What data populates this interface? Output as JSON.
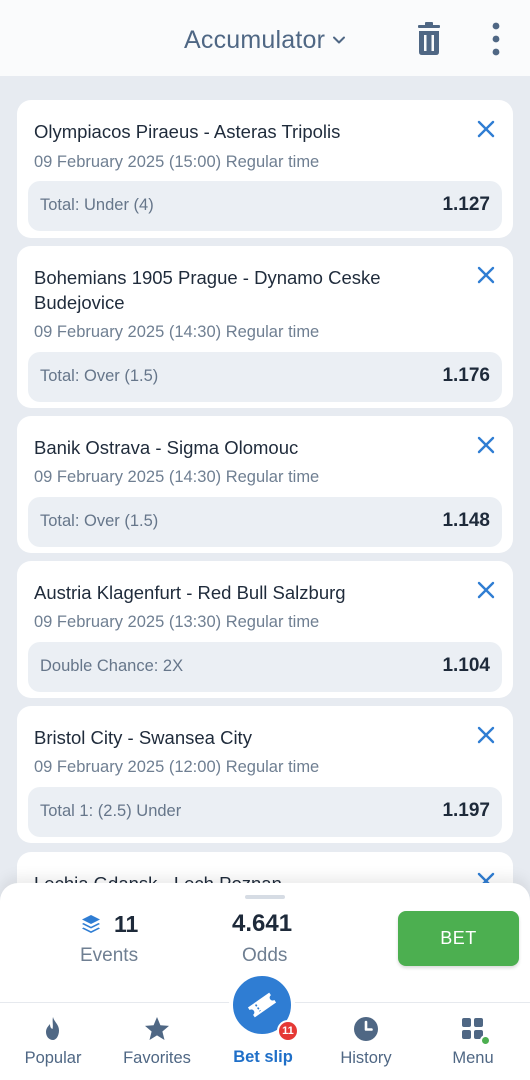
{
  "header": {
    "title": "Accumulator",
    "icons": [
      "chevron-down-icon",
      "trash-icon",
      "kebab-menu-icon"
    ]
  },
  "bets": [
    {
      "teams": "Olympiacos Piraeus - Asteras Tripolis",
      "when": "09 February 2025 (15:00) Regular time",
      "market": "Total: Under (4)",
      "odds": "1.127"
    },
    {
      "teams": "Bohemians 1905 Prague - Dynamo Ceske Budejovice",
      "when": "09 February 2025 (14:30) Regular time",
      "market": "Total: Over (1.5)",
      "odds": "1.176"
    },
    {
      "teams": "Banik Ostrava - Sigma Olomouc",
      "when": "09 February 2025 (14:30) Regular time",
      "market": "Total: Over (1.5)",
      "odds": "1.148"
    },
    {
      "teams": "Austria Klagenfurt - Red Bull Salzburg",
      "when": "09 February 2025 (13:30) Regular time",
      "market": "Double Chance: 2X",
      "odds": "1.104"
    },
    {
      "teams": "Bristol City - Swansea City",
      "when": "09 February 2025 (12:00) Regular time",
      "market": "Total 1: (2.5) Under",
      "odds": "1.197"
    },
    {
      "teams": "Lechia Gdansk - Lech Poznan"
    }
  ],
  "summary": {
    "events_count": "11",
    "events_label": "Events",
    "odds_value": "4.641",
    "odds_label": "Odds",
    "bet_label": "BET"
  },
  "nav": {
    "items": [
      {
        "label": "Popular",
        "icon": "flame-icon"
      },
      {
        "label": "Favorites",
        "icon": "star-icon"
      },
      {
        "label": "Bet slip",
        "icon": "ticket-icon",
        "badge": "11"
      },
      {
        "label": "History",
        "icon": "clock-icon"
      },
      {
        "label": "Menu",
        "icon": "grid-icon"
      }
    ]
  },
  "colors": {
    "accent_blue": "#2f7dd3",
    "bet_green": "#4caf50",
    "badge_red": "#e53935",
    "header_text": "#4f6784"
  }
}
